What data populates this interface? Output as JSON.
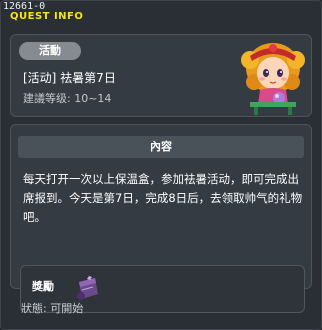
{
  "window": {
    "id": "12661-0",
    "title": "QUEST INFO"
  },
  "quest": {
    "category": "活動",
    "name": "[活动] 祛暑第7日",
    "level": "建議等级: 10~14",
    "npc_icon": "npc-girl-portrait"
  },
  "content": {
    "header": "內容",
    "description": "每天打开一次以上保温盒，参加祛暑活动，即可完成出席报到。今天是第7日，完成8日后，去领取帅气的礼物吧。"
  },
  "reward": {
    "label": "獎勵",
    "item_icon": "scroll-item-icon"
  },
  "status": {
    "label": "狀態:",
    "value": "可開始"
  },
  "colors": {
    "title": "#f5e51a",
    "panel": "#353b42",
    "background": "#2a2f35"
  }
}
